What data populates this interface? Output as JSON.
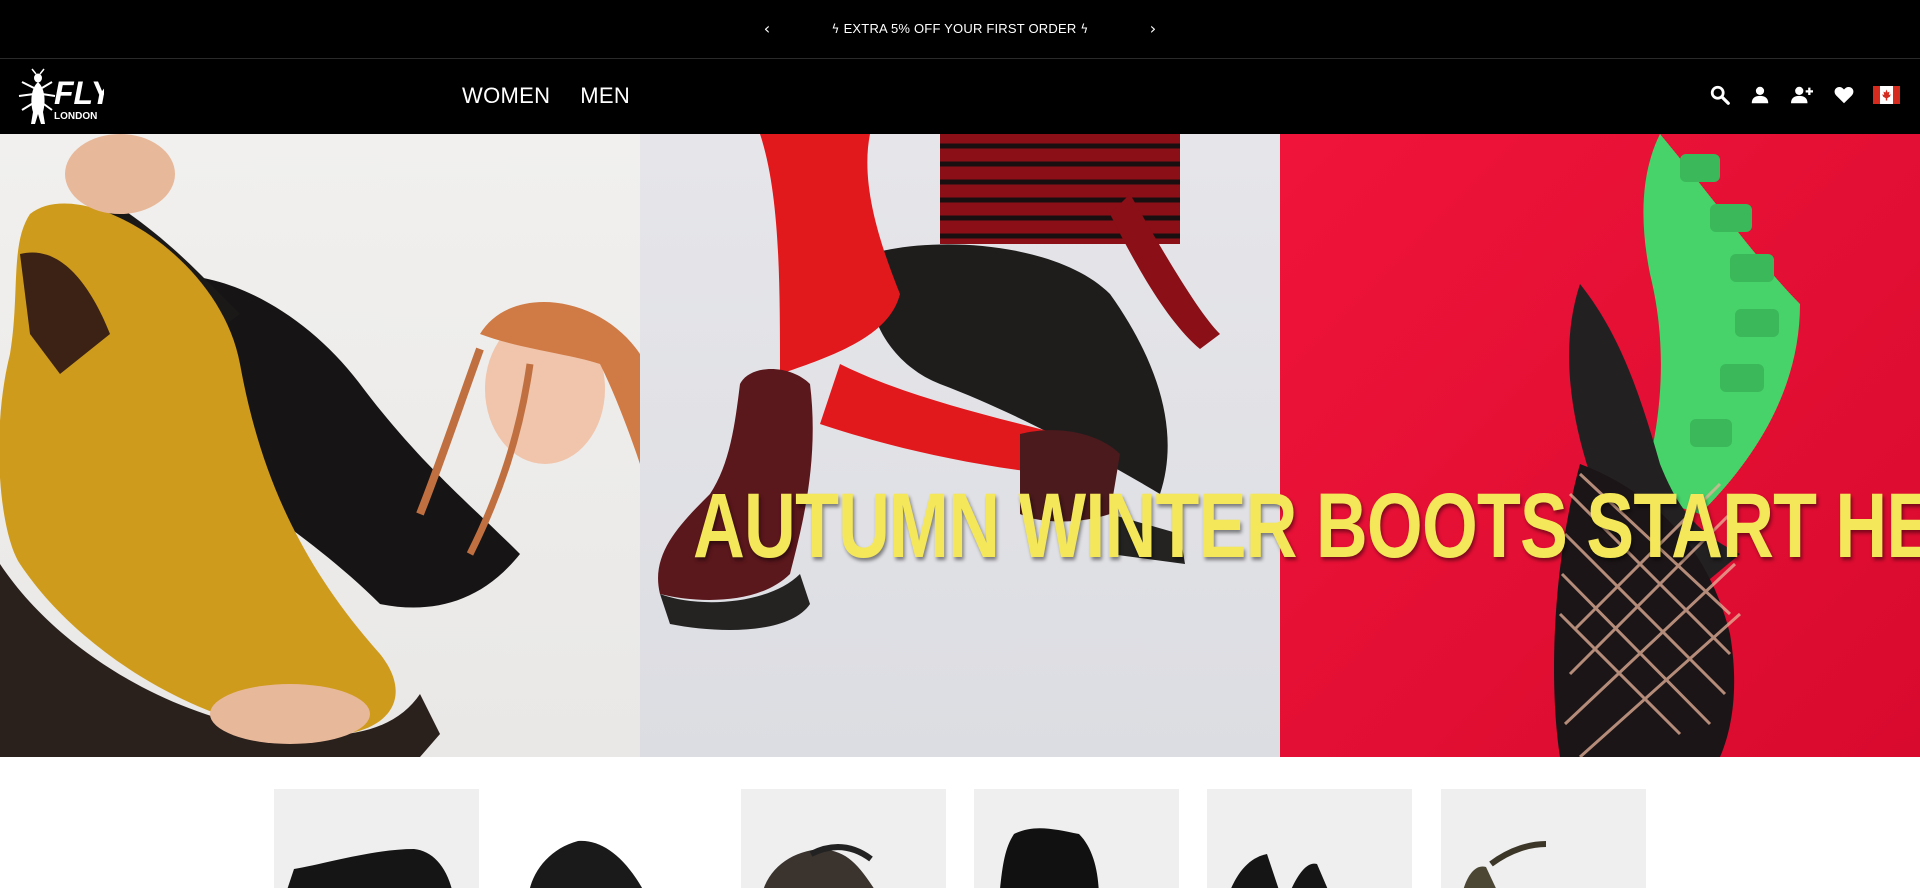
{
  "announcement": {
    "prev_icon": "chevron-left-icon",
    "next_icon": "chevron-right-icon",
    "icon": "lightning-bolt-icon",
    "message": "EXTRA 5% OFF YOUR FIRST ORDER"
  },
  "header": {
    "logo": {
      "brand": "FLY",
      "sub": "LONDON"
    },
    "nav": [
      {
        "label": "WOMEN"
      },
      {
        "label": "MEN"
      }
    ],
    "icons": [
      "search-icon",
      "account-icon",
      "register-icon",
      "wishlist-icon",
      "canada-flag-icon"
    ]
  },
  "hero": {
    "headline": "AUTUMN WINTER BOOTS START HERE...",
    "headline_color": "#f4e75a",
    "panel_colors": [
      "#efeeec",
      "#e2e3e7",
      "#e8102f"
    ]
  },
  "products": {
    "thumbnails": [
      {
        "name": "black-loafer-shoe"
      },
      {
        "name": "black-leather-shoe"
      },
      {
        "name": "bronze-mary-jane-shoe"
      },
      {
        "name": "black-chelsea-boot"
      },
      {
        "name": "black-loafer-pair"
      },
      {
        "name": "olive-mary-jane-shoe"
      }
    ]
  }
}
